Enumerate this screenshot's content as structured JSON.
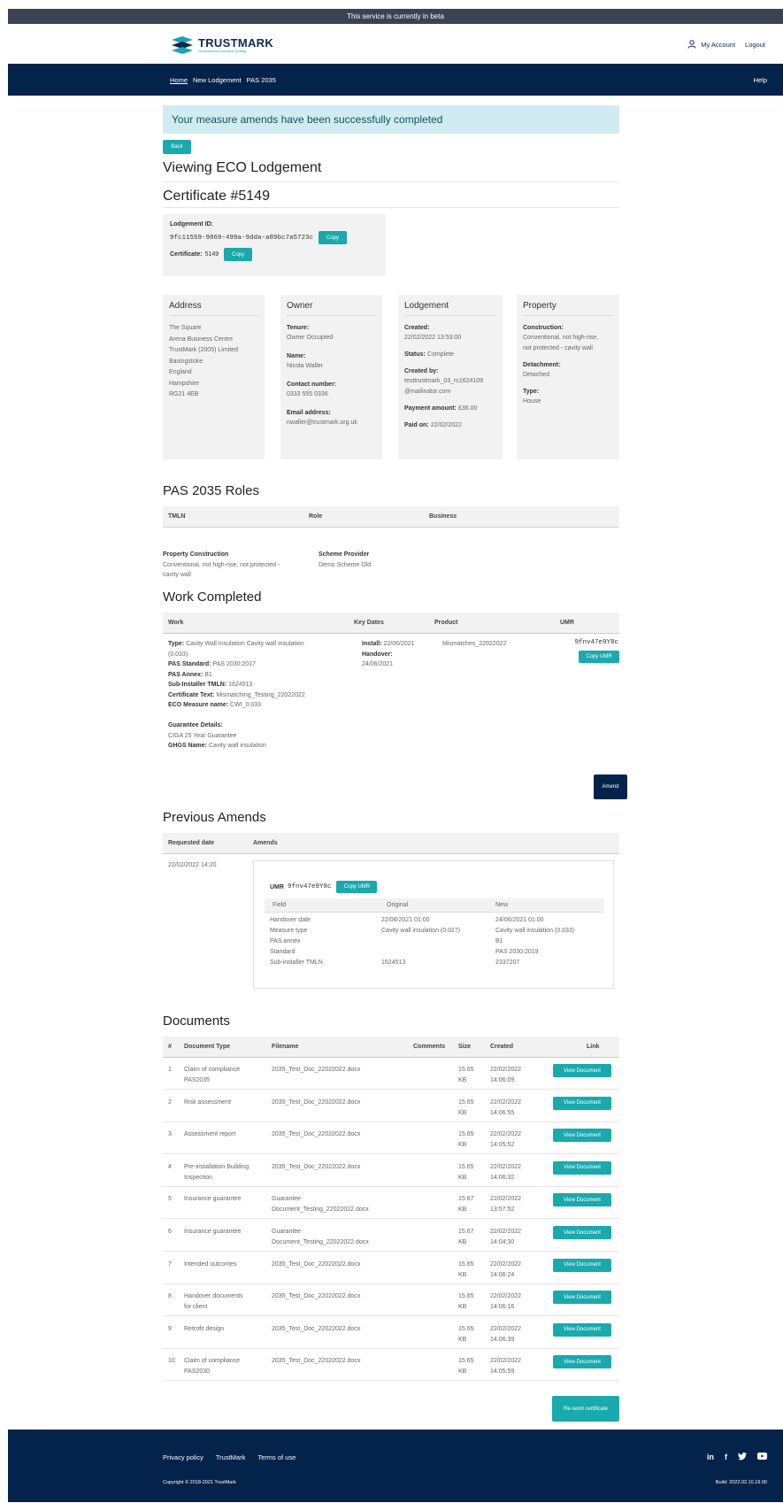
{
  "banner": {
    "text": "This service is currently in beta"
  },
  "header": {
    "logo_title": "TRUSTMARK",
    "logo_subtitle": "Government Endorsed Quality",
    "my_account": "My Account",
    "logout": "Logout"
  },
  "nav": {
    "items": [
      "Home",
      "New Lodgement",
      "PAS 2035"
    ],
    "help": "Help"
  },
  "alert": {
    "text": "Your measure amends have been successfully completed"
  },
  "back_label": "Back",
  "page_title": "Viewing ECO Lodgement",
  "certificate_title": "Certificate #5149",
  "lodgement_box": {
    "id_label": "Lodgement ID:",
    "id_value": "9fc11559-9869-499a-9dda-a89bc7a5723c",
    "copy": "Copy",
    "cert_label": "Certificate:",
    "cert_value": "5149"
  },
  "address": {
    "title": "Address",
    "lines": [
      "The Square",
      "Arena Business Centre",
      "TrustMark (2005) Limited",
      "Basingstoke",
      "England",
      "Hampshire",
      "RG21 4EB"
    ]
  },
  "owner": {
    "title": "Owner",
    "fields": [
      {
        "label": "Tenure:",
        "value": "Owner Occupied"
      },
      {
        "label": "Name:",
        "value": "Nicola Waller"
      },
      {
        "label": "Contact number:",
        "value": "0333 555 0336"
      },
      {
        "label": "Email address:",
        "value": "nwaller@trustmark.org.uk"
      }
    ]
  },
  "lodgement": {
    "title": "Lodgement",
    "created_label": "Created:",
    "created_value": "22/02/2022 13:53:00",
    "status_label": "Status:",
    "status_value": "Complete",
    "created_by_label": "Created by:",
    "created_by_value1": "testtrustmark_03_rc1624109",
    "created_by_value2": "@mailinator.com",
    "payment_label": "Payment amount:",
    "payment_value": "£36.00",
    "paid_label": "Paid on:",
    "paid_value": "22/02/2022"
  },
  "property": {
    "title": "Property",
    "construction_label": "Construction:",
    "construction_value1": "Conventional, not high-rise,",
    "construction_value2": "not protected - cavity wall",
    "detachment_label": "Detachment:",
    "detachment_value": "Detached",
    "type_label": "Type:",
    "type_value": "House"
  },
  "roles": {
    "title": "PAS 2035 Roles",
    "headers": [
      "TMLN",
      "Role",
      "Business"
    ],
    "prop_construction_label": "Property Construction",
    "prop_construction_value1": "Conventional, not high-rise, not protected -",
    "prop_construction_value2": "cavity wall",
    "scheme_label": "Scheme Provider",
    "scheme_value": "Demo Scheme Old"
  },
  "work": {
    "title": "Work Completed",
    "headers": [
      "Work",
      "Key Dates",
      "Product",
      "UMR"
    ],
    "type_label": "Type:",
    "type_value": "Cavity Wall Insulation Cavity wall insulation",
    "type_value2": "(0.033)",
    "standard_label": "PAS Standard:",
    "standard_value": "PAS 2030:2017",
    "annex_label": "PAS Annex:",
    "annex_value": "B1",
    "sub_label": "Sub-Installer TMLN:",
    "sub_value": "1624513",
    "cert_label": "Certificate Text:",
    "cert_value": "Mismatching_Testing_22022022",
    "eco_label": "ECO Measure name:",
    "eco_value": "CWI_0.033",
    "guarantee_label": "Guarantee Details:",
    "guarantee_value": "CIGA 25 Year Guarantee",
    "ghgs_label": "GHGS Name:",
    "ghgs_value": "Cavity wall insulation",
    "install_label": "Install:",
    "install_value": "22/06/2021",
    "handover_label": "Handover:",
    "handover_value": "24/06/2021",
    "product": "Mismatches_22022022",
    "umr": "9fnv47e9Y8c",
    "copy_umr": "Copy UMR",
    "amend": "Amend"
  },
  "amends": {
    "title": "Previous Amends",
    "headers": [
      "Requested date",
      "Amends"
    ],
    "date": "22/02/2022 14:20",
    "umr_label": "UMR",
    "umr_value": "9fnv47e9Y8c",
    "copy_umr": "Copy UMR",
    "sub_headers": [
      "Field",
      "Original",
      "New"
    ],
    "rows": [
      [
        "Handover date",
        "22/06/2021 01:00",
        "24/06/2021 01:00"
      ],
      [
        "Measure type",
        "Cavity wall insulation (0.027)",
        "Cavity wall insulation (0.033)"
      ],
      [
        "PAS annex",
        "",
        "B1"
      ],
      [
        "Standard",
        "",
        "PAS 2030:2019"
      ],
      [
        "Sub-installer TMLN",
        "1624513",
        "2337207"
      ]
    ]
  },
  "documents": {
    "title": "Documents",
    "headers": [
      "#",
      "Document Type",
      "Filename",
      "Comments",
      "Size",
      "Created",
      "Link"
    ],
    "view_label": "View Document",
    "rows": [
      {
        "n": "1",
        "type1": "Claim of compliance",
        "type2": "PAS2035",
        "file1": "2035_Test_Doc_22022022.docx",
        "file2": "",
        "size1": "15.65",
        "size2": "KB",
        "date": "22/02/2022",
        "time": "14:06:09"
      },
      {
        "n": "2",
        "type1": "Risk assessment",
        "type2": "",
        "file1": "2035_Test_Doc_22022022.docx",
        "file2": "",
        "size1": "15.65",
        "size2": "KB",
        "date": "22/02/2022",
        "time": "14:06:55"
      },
      {
        "n": "3",
        "type1": "Assessment report",
        "type2": "",
        "file1": "2035_Test_Doc_22022022.docx",
        "file2": "",
        "size1": "15.65",
        "size2": "KB",
        "date": "22/02/2022",
        "time": "14:05:52"
      },
      {
        "n": "4",
        "type1": "Pre-installation Building",
        "type2": "Inspection",
        "file1": "2035_Test_Doc_22022022.docx",
        "file2": "",
        "size1": "15.65",
        "size2": "KB",
        "date": "22/02/2022",
        "time": "14:06:32"
      },
      {
        "n": "5",
        "type1": "Insurance guarantee",
        "type2": "",
        "file1": "Guarantee",
        "file2": "Document_Testing_22022022.docx",
        "size1": "15.67",
        "size2": "KB",
        "date": "22/02/2022",
        "time": "13:57:52"
      },
      {
        "n": "6",
        "type1": "Insurance guarantee",
        "type2": "",
        "file1": "Guarantee",
        "file2": "Document_Testing_22022022.docx",
        "size1": "15.67",
        "size2": "KB",
        "date": "22/02/2022",
        "time": "14:04:30"
      },
      {
        "n": "7",
        "type1": "Intended outcomes",
        "type2": "",
        "file1": "2035_Test_Doc_22022022.docx",
        "file2": "",
        "size1": "15.65",
        "size2": "KB",
        "date": "22/02/2022",
        "time": "14:06:24"
      },
      {
        "n": "8",
        "type1": "Handover documents",
        "type2": "for client",
        "file1": "2035_Test_Doc_22022022.docx",
        "file2": "",
        "size1": "15.65",
        "size2": "KB",
        "date": "22/02/2022",
        "time": "14:06:16"
      },
      {
        "n": "9",
        "type1": "Retrofit design",
        "type2": "",
        "file1": "2035_Test_Doc_22022022.docx",
        "file2": "",
        "size1": "15.65",
        "size2": "KB",
        "date": "22/02/2022",
        "time": "14:06:39"
      },
      {
        "n": "10",
        "type1": "Claim of compliance",
        "type2": "PAS2030",
        "file1": "2035_Test_Doc_22022022.docx",
        "file2": "",
        "size1": "15.65",
        "size2": "KB",
        "date": "22/02/2022",
        "time": "14:05:59"
      }
    ]
  },
  "resend": "Re-send certificate",
  "footer": {
    "links": [
      "Privacy policy",
      "TrustMark",
      "Terms of use"
    ],
    "copyright": "Copyright © 2018-2021 TrustMark",
    "build": "Build: 2022.02.10.19.00",
    "social": [
      "linkedin-icon",
      "facebook-icon",
      "twitter-icon",
      "youtube-icon"
    ]
  },
  "colors": {
    "navy": "#04234a",
    "teal": "#1aa9ad",
    "alert_bg": "#d1ecf1",
    "alert_text": "#0c5460"
  }
}
